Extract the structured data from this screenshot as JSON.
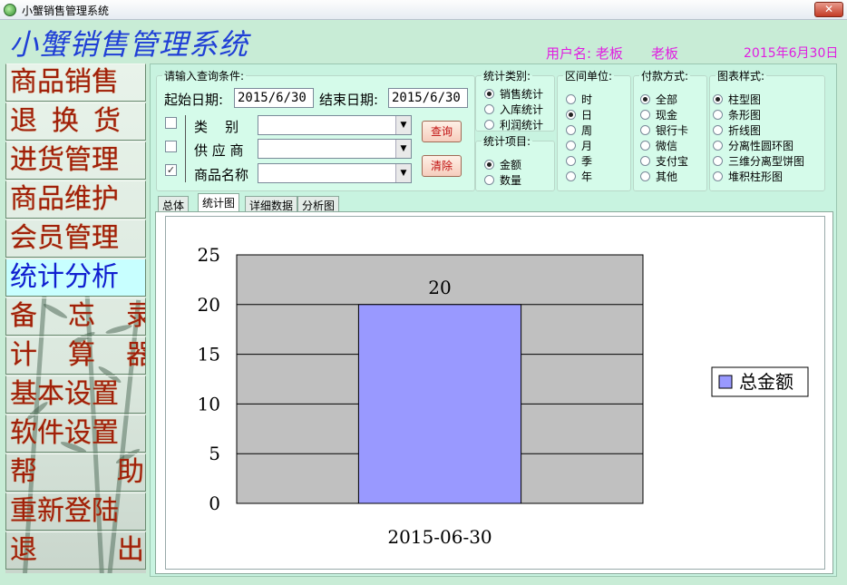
{
  "window": {
    "title": "小蟹销售管理系统",
    "close_glyph": "✕"
  },
  "header": {
    "app_title": "小蟹销售管理系统",
    "user_label": "用户名: 老板",
    "user_name": "老板",
    "date": "2015年6月30日"
  },
  "sidebar": {
    "items": [
      {
        "label": "商品销售"
      },
      {
        "label": "退换货"
      },
      {
        "label": "进货管理"
      },
      {
        "label": "商品维护"
      },
      {
        "label": "会员管理"
      },
      {
        "label": "统计分析"
      },
      {
        "label": "备忘录"
      },
      {
        "label": "计算器"
      },
      {
        "label": "基本设置"
      },
      {
        "label": "软件设置"
      },
      {
        "label": "帮助"
      },
      {
        "label": "重新登陆"
      },
      {
        "label": "退出"
      }
    ],
    "active_index": 5
  },
  "query": {
    "legend": "请输入查询条件:",
    "start_label": "起始日期:",
    "start_value": "2015/6/30",
    "end_label": "结束日期:",
    "end_value": "2015/6/30",
    "category_label": "类    别",
    "supplier_label": "供 应 商",
    "product_label": "商品名称",
    "category_checked": false,
    "supplier_checked": false,
    "product_checked": true,
    "check_mark": "✓",
    "query_button": "查询",
    "clear_button": "清除",
    "dropdown_arrow": "▼"
  },
  "stat_type": {
    "legend": "统计类别:",
    "options": [
      "销售统计",
      "入库统计",
      "利润统计"
    ],
    "selected": 0
  },
  "stat_item": {
    "legend": "统计项目:",
    "options": [
      "金额",
      "数量"
    ],
    "selected": 0
  },
  "interval": {
    "legend": "区间单位:",
    "options": [
      "时",
      "日",
      "周",
      "月",
      "季",
      "年"
    ],
    "selected": 1
  },
  "payment": {
    "legend": "付款方式:",
    "options": [
      "全部",
      "现金",
      "银行卡",
      "微信",
      "支付宝",
      "其他"
    ],
    "selected": 0
  },
  "chart_style": {
    "legend": "图表样式:",
    "options": [
      "柱型图",
      "条形图",
      "折线图",
      "分离性圆环图",
      "三维分离型饼图",
      "堆积柱形图"
    ],
    "selected": 0
  },
  "tabs": [
    {
      "label": "总体"
    },
    {
      "label": "统计图"
    },
    {
      "label": "详细数据"
    },
    {
      "label": "分析图"
    }
  ],
  "active_tab": 1,
  "chart_data": {
    "type": "bar",
    "categories": [
      "2015-06-30"
    ],
    "series": [
      {
        "name": "总金额",
        "values": [
          20
        ]
      }
    ],
    "ylim": [
      0,
      25
    ],
    "yticks": [
      0,
      5,
      10,
      15,
      20,
      25
    ],
    "grid": true,
    "legend": "right",
    "data_labels": true,
    "colors": {
      "bar": "#9999ff",
      "plot_bg": "#c0c0c0"
    }
  }
}
